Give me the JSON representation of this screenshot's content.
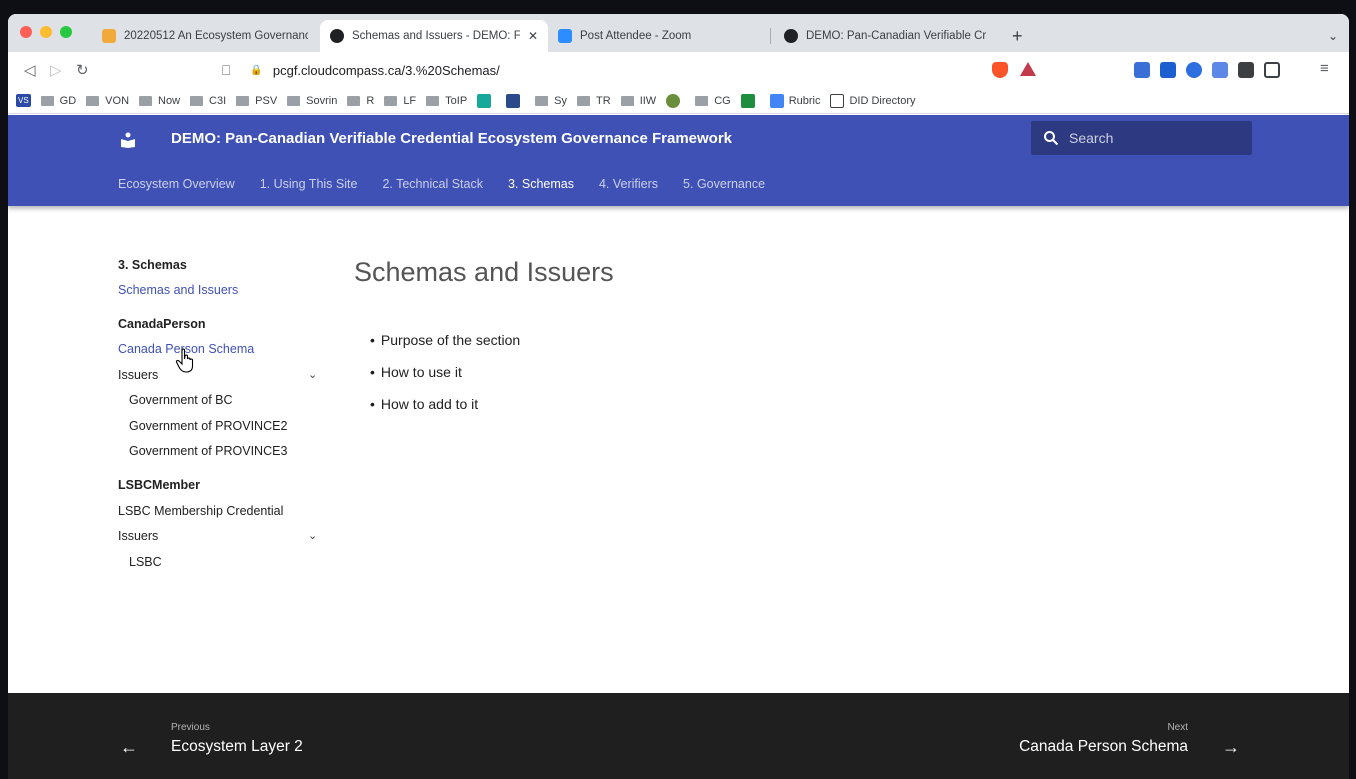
{
  "browser": {
    "tabs": [
      {
        "title": "20220512 An Ecosystem Governanc",
        "active": false,
        "favicon": "calendar-icon",
        "color": "#f2a93b"
      },
      {
        "title": "Schemas and Issuers - DEMO: F",
        "active": true,
        "favicon": "github-icon",
        "color": "#202124"
      },
      {
        "title": "Post Attendee - Zoom",
        "active": false,
        "favicon": "zoom-icon",
        "color": "#2d8cff"
      },
      {
        "title": "DEMO: Pan-Canadian Verifiable Cre",
        "active": false,
        "favicon": "github-icon",
        "color": "#202124"
      }
    ],
    "new_tab": "+",
    "close_tab": "✕",
    "url": "pcgf.cloudcompass.ca/3.%20Schemas/",
    "bookmarks": [
      "GD",
      "VON",
      "Now",
      "C3I",
      "PSV",
      "Sovrin",
      "R",
      "LF",
      "ToIP",
      "Sy",
      "TR",
      "IIW",
      "CG",
      "Rubric",
      "DID Directory"
    ],
    "bookmark_first": "VS"
  },
  "site": {
    "title": "DEMO: Pan-Canadian Verifiable Credential Ecosystem Governance Framework",
    "search_placeholder": "Search",
    "nav": [
      "Ecosystem Overview",
      "1. Using This Site",
      "2. Technical Stack",
      "3. Schemas",
      "4. Verifiers",
      "5. Governance"
    ],
    "nav_current_index": 3,
    "accent_color": "#3f51b5"
  },
  "sidebar": {
    "section_title": "3. Schemas",
    "section_link": "Schemas and Issuers",
    "groups": [
      {
        "title": "CanadaPerson",
        "schema_link": "Canada Person Schema",
        "issuers_label": "Issuers",
        "issuers": [
          "Government of BC",
          "Government of PROVINCE2",
          "Government of PROVINCE3"
        ]
      },
      {
        "title": "LSBCMember",
        "schema_link": "LSBC Membership Credential",
        "issuers_label": "Issuers",
        "issuers": [
          "LSBC"
        ]
      }
    ]
  },
  "main": {
    "title": "Schemas and Issuers",
    "bullets": [
      "Purpose of the section",
      "How to use it",
      "How to add to it"
    ]
  },
  "footer": {
    "prev_label": "Previous",
    "prev_title": "Ecosystem Layer 2",
    "next_label": "Next",
    "next_title": "Canada Person Schema"
  }
}
